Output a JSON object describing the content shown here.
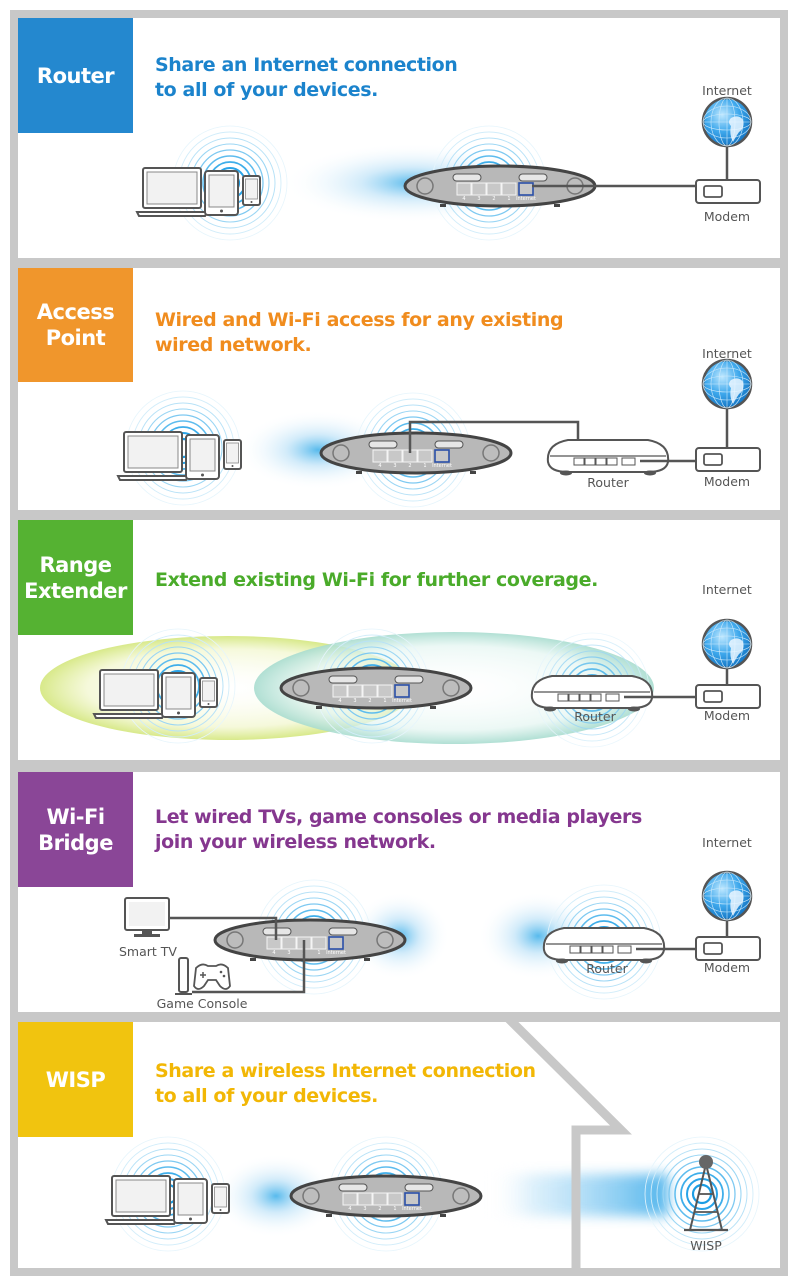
{
  "colors": {
    "router": "#2488cf",
    "access_point": "#f0962c",
    "range_extender": "#55b232",
    "wifi_bridge": "#8a4697",
    "wisp": "#f1c40f",
    "wisp_text": "#f2b705",
    "frame": "#c8c8c8",
    "signal": "#2aa4e8"
  },
  "panels": [
    {
      "id": "router",
      "mode_label": "Router",
      "headline_line1": "Share an Internet connection",
      "headline_line2": "to all of your devices.",
      "labels": {
        "internet": "Internet",
        "modem": "Modem"
      }
    },
    {
      "id": "access_point",
      "mode_label_line1": "Access",
      "mode_label_line2": "Point",
      "headline_line1": "Wired and Wi-Fi access for any existing",
      "headline_line2": "wired network.",
      "labels": {
        "internet": "Internet",
        "modem": "Modem",
        "router": "Router"
      }
    },
    {
      "id": "range_extender",
      "mode_label_line1": "Range",
      "mode_label_line2": "Extender",
      "headline_line1": "Extend existing Wi-Fi for further coverage.",
      "labels": {
        "internet": "Internet",
        "modem": "Modem",
        "router": "Router"
      }
    },
    {
      "id": "wifi_bridge",
      "mode_label_line1": "Wi-Fi",
      "mode_label_line2": "Bridge",
      "headline_line1": "Let wired TVs, game consoles or media players",
      "headline_line2": "join your wireless network.",
      "labels": {
        "internet": "Internet",
        "modem": "Modem",
        "router": "Router",
        "smart_tv": "Smart TV",
        "game_console": "Game Console"
      }
    },
    {
      "id": "wisp",
      "mode_label": "WISP",
      "headline_line1": "Share a wireless Internet connection",
      "headline_line2": "to all of your devices.",
      "labels": {
        "wisp_tower": "WISP"
      }
    }
  ],
  "device_ports": {
    "lan": [
      "4",
      "3",
      "2",
      "1"
    ],
    "wan": "Internet"
  },
  "icons": [
    "laptop-icon",
    "tablet-icon",
    "phone-icon",
    "wireless-device-icon",
    "globe-icon",
    "modem-icon",
    "router-icon",
    "smart-tv-icon",
    "game-console-icon",
    "wisp-tower-icon",
    "house-outline",
    "wifi-signal-icon"
  ]
}
